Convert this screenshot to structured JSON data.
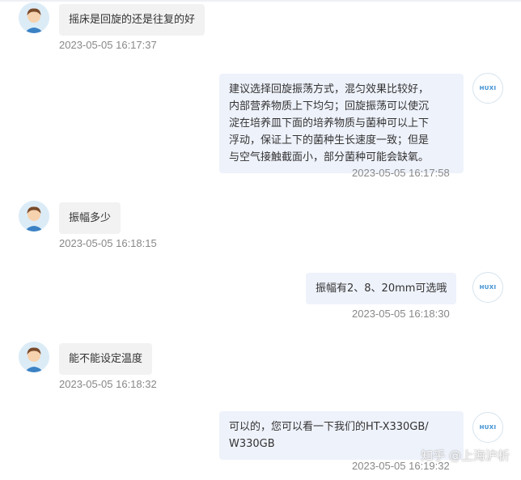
{
  "user_avatar_icon": "user-avatar-icon",
  "bot_avatar": {
    "icon": "huxi-logo-icon",
    "text": "HUXI"
  },
  "messages": [
    {
      "role": "user",
      "text": "摇床是回旋的还是往复的好",
      "time": "2023-05-05 16:17:37"
    },
    {
      "role": "bot",
      "text": "建议选择回旋振荡方式，混匀效果比较好，\n内部营养物质上下均匀；回旋振荡可以使沉\n淀在培养皿下面的培养物质与菌种可以上下\n浮动，保证上下的菌种生长速度一致；但是\n与空气接触截面小，部分菌种可能会缺氧。",
      "time": "2023-05-05 16:17:58"
    },
    {
      "role": "user",
      "text": "振幅多少",
      "time": "2023-05-05 16:18:15"
    },
    {
      "role": "bot",
      "text": "振幅有2、8、20mm可选哦",
      "time": "2023-05-05 16:18:30"
    },
    {
      "role": "user",
      "text": "能不能设定温度",
      "time": "2023-05-05 16:18:32"
    },
    {
      "role": "bot",
      "text": "可以的，您可以看一下我们的HT-X330GB/\nW330GB",
      "time": "2023-05-05 16:19:32"
    }
  ],
  "watermark": "知乎 @上海沪析"
}
